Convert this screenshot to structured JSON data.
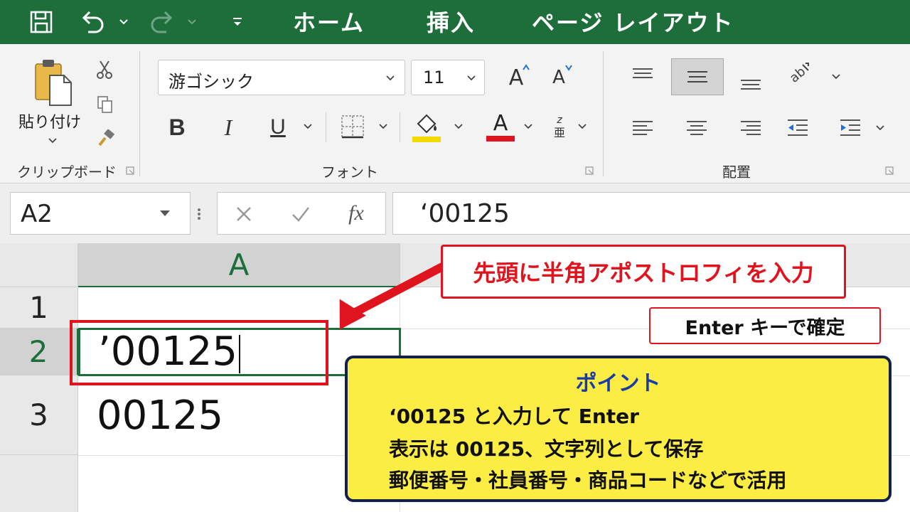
{
  "quick_access": {
    "save_icon": "save-icon",
    "undo_icon": "undo-icon",
    "redo_icon": "redo-icon",
    "customize_icon": "customize-qat-icon"
  },
  "tabs": [
    "ホーム",
    "挿入",
    "ページ レイアウト"
  ],
  "ribbon": {
    "clipboard": {
      "paste_label": "貼り付け",
      "group_label": "クリップボード"
    },
    "font": {
      "font_name": "游ゴシック",
      "font_size": "11",
      "bold": "B",
      "italic": "I",
      "underline": "U",
      "font_color_letter": "A",
      "increase_font_letter": "A",
      "decrease_font_letter": "A",
      "phonetic_top": "z",
      "phonetic_bottom": "亜",
      "group_label": "フォント",
      "fill_color": "#f2d900",
      "font_color": "#e0141e"
    },
    "alignment": {
      "group_label": "配置"
    }
  },
  "formula_bar": {
    "name_box": "A2",
    "fx_label": "fx",
    "content": "‘00125"
  },
  "sheet": {
    "column_header": "A",
    "row_headers": [
      "1",
      "2",
      "3"
    ],
    "cell_a2": "’00125",
    "cell_a3": "00125"
  },
  "annotations": {
    "callout": "先頭に半角アポストロフィを入力",
    "enter_note": "Enter キーで確定",
    "point": {
      "title": "ポイント",
      "lines": [
        "‘00125 と入力して Enter",
        "表示は 00125、文字列として保存",
        "郵便番号・社員番号・商品コードなどで活用"
      ]
    }
  },
  "colors": {
    "excel_green": "#1e6e3c",
    "callout_red": "#e0141e",
    "point_yellow": "#fbed44",
    "point_title_blue": "#1a3aa8",
    "point_border": "#13204a"
  }
}
